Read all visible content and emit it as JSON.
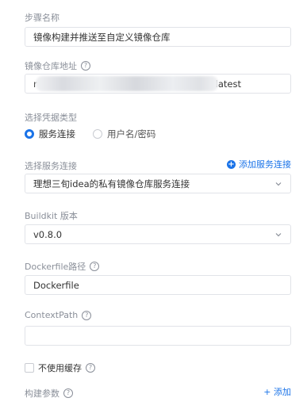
{
  "step_name": {
    "label": "步骤名称",
    "value": "镜像构建并推送至自定义镜像仓库"
  },
  "registry": {
    "label": "镜像仓库地址",
    "value_prefix": "r",
    "value_suffix": "latest"
  },
  "credential": {
    "label": "选择凭据类型",
    "options": [
      "服务连接",
      "用户名/密码"
    ],
    "selected": "服务连接"
  },
  "service_connection": {
    "label": "选择服务连接",
    "add_label": "添加服务连接",
    "value": "理想三旬idea的私有镜像仓库服务连接"
  },
  "buildkit": {
    "label": "Buildkit 版本",
    "value": "v0.8.0"
  },
  "dockerfile": {
    "label": "Dockerfile路径",
    "value": "Dockerfile"
  },
  "context_path": {
    "label": "ContextPath",
    "value": ""
  },
  "no_cache": {
    "label": "不使用缓存",
    "checked": false
  },
  "build_args": {
    "label": "构建参数",
    "add_label": "+ 添加"
  },
  "colors": {
    "accent": "#1a73e8",
    "label": "#8a8f99",
    "border": "#e1e3e8"
  }
}
